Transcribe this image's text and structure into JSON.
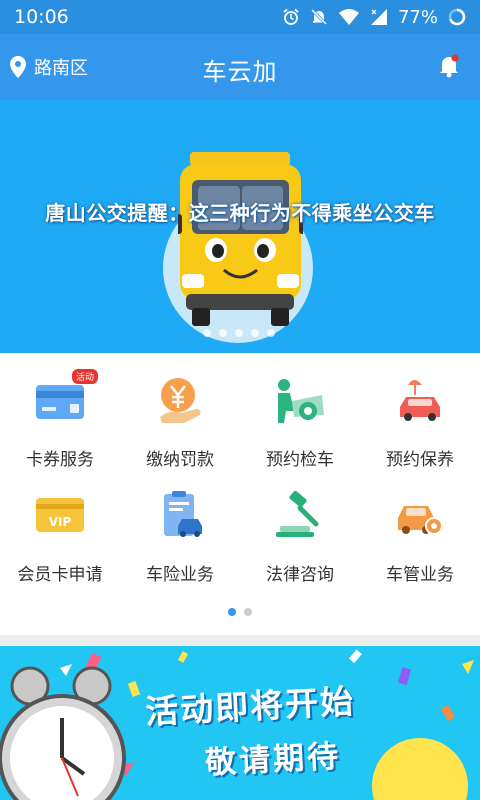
{
  "status_bar": {
    "time": "10:06",
    "battery": "77%"
  },
  "app_bar": {
    "location": "路南区",
    "title": "车云加"
  },
  "banner": {
    "headline": "唐山公交提醒：这三种行为不得乘坐公交车",
    "page_count": 5,
    "active_page": 0
  },
  "services": [
    {
      "label": "卡券服务",
      "icon": "card-icon",
      "badge": "活动"
    },
    {
      "label": "缴纳罚款",
      "icon": "yuan-payment-icon"
    },
    {
      "label": "预约检车",
      "icon": "car-inspection-icon"
    },
    {
      "label": "预约保养",
      "icon": "car-maintenance-icon"
    },
    {
      "label": "会员卡申请",
      "icon": "vip-card-icon"
    },
    {
      "label": "车险业务",
      "icon": "car-insurance-icon"
    },
    {
      "label": "法律咨询",
      "icon": "gavel-icon"
    },
    {
      "label": "车管业务",
      "icon": "car-settings-icon"
    }
  ],
  "grid_pager": {
    "pages": 2,
    "active": 0
  },
  "promo": {
    "line1": "活动即将开始",
    "line2": "敬请期待"
  },
  "colors": {
    "primary": "#3597eb",
    "banner_bg": "#1faaf5",
    "promo_bg": "#21c6f3",
    "badge_red": "#e8332f",
    "pager_active": "#3597eb",
    "pager_inactive": "#cccccc"
  }
}
